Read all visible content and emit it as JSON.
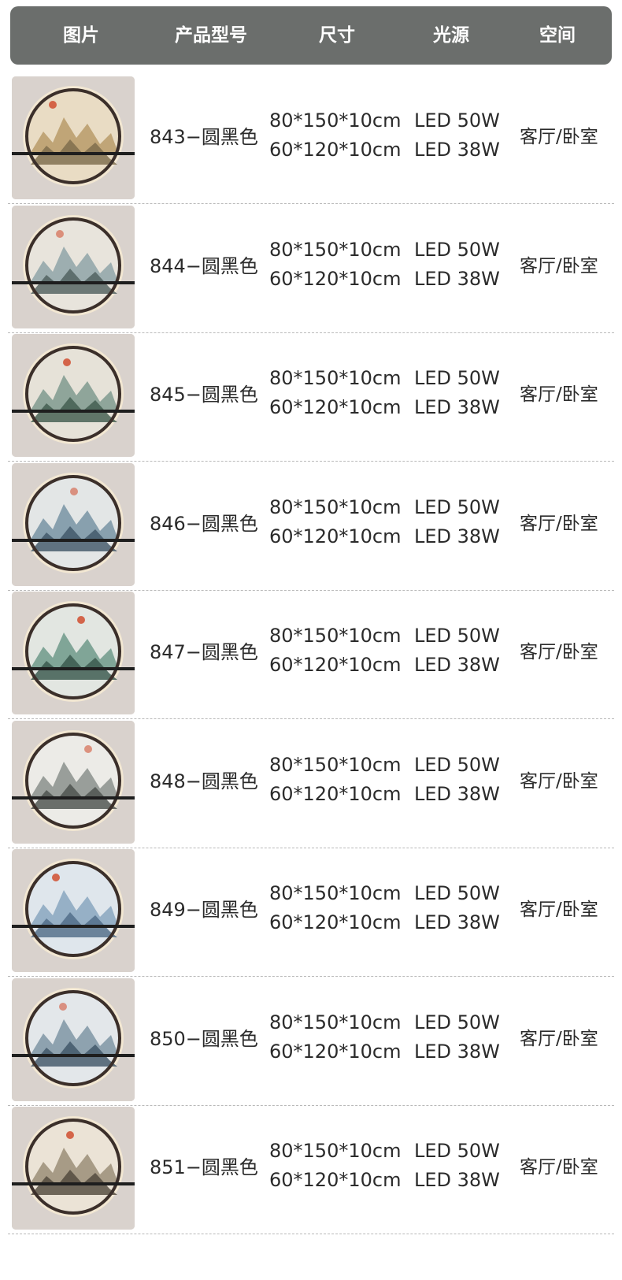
{
  "header": {
    "col_image": "图片",
    "col_model": "产品型号",
    "col_size": "尺寸",
    "col_light": "光源",
    "col_space": "空间"
  },
  "colors": {
    "header_bg": "#6b6e6c",
    "header_text": "#ffffff",
    "body_text": "#2b2b2b",
    "thumb_bg": "#d9d2cd",
    "ring": "#3b2f2a",
    "glow": "#f4e9d3"
  },
  "rows": [
    {
      "model": "843−圆黑色",
      "size_large": "80*150*10cm",
      "size_small": "60*120*10cm",
      "light_large": "LED 50W",
      "light_small": "LED 38W",
      "space": "客厅/卧室",
      "image_icon": "landscape-wall-lamp-icon"
    },
    {
      "model": "844−圆黑色",
      "size_large": "80*150*10cm",
      "size_small": "60*120*10cm",
      "light_large": "LED 50W",
      "light_small": "LED 38W",
      "space": "客厅/卧室",
      "image_icon": "landscape-wall-lamp-icon"
    },
    {
      "model": "845−圆黑色",
      "size_large": "80*150*10cm",
      "size_small": "60*120*10cm",
      "light_large": "LED 50W",
      "light_small": "LED 38W",
      "space": "客厅/卧室",
      "image_icon": "landscape-wall-lamp-icon"
    },
    {
      "model": "846−圆黑色",
      "size_large": "80*150*10cm",
      "size_small": "60*120*10cm",
      "light_large": "LED 50W",
      "light_small": "LED 38W",
      "space": "客厅/卧室",
      "image_icon": "landscape-wall-lamp-icon"
    },
    {
      "model": "847−圆黑色",
      "size_large": "80*150*10cm",
      "size_small": "60*120*10cm",
      "light_large": "LED 50W",
      "light_small": "LED 38W",
      "space": "客厅/卧室",
      "image_icon": "landscape-wall-lamp-icon"
    },
    {
      "model": "848−圆黑色",
      "size_large": "80*150*10cm",
      "size_small": "60*120*10cm",
      "light_large": "LED 50W",
      "light_small": "LED 38W",
      "space": "客厅/卧室",
      "image_icon": "landscape-wall-lamp-icon"
    },
    {
      "model": "849−圆黑色",
      "size_large": "80*150*10cm",
      "size_small": "60*120*10cm",
      "light_large": "LED 50W",
      "light_small": "LED 38W",
      "space": "客厅/卧室",
      "image_icon": "landscape-wall-lamp-icon"
    },
    {
      "model": "850−圆黑色",
      "size_large": "80*150*10cm",
      "size_small": "60*120*10cm",
      "light_large": "LED 50W",
      "light_small": "LED 38W",
      "space": "客厅/卧室",
      "image_icon": "landscape-wall-lamp-icon"
    },
    {
      "model": "851−圆黑色",
      "size_large": "80*150*10cm",
      "size_small": "60*120*10cm",
      "light_large": "LED 50W",
      "light_small": "LED 38W",
      "space": "客厅/卧室",
      "image_icon": "landscape-wall-lamp-icon"
    }
  ]
}
